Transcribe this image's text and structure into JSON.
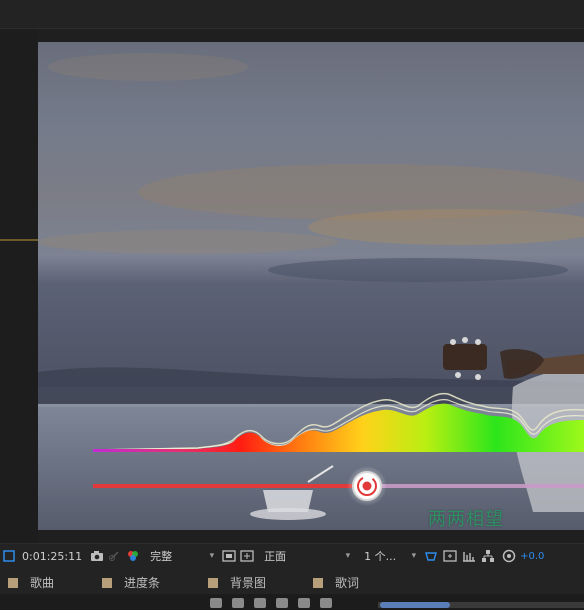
{
  "viewer": {
    "watermark": "两两相望"
  },
  "toolbar": {
    "timecode": "0:01:25:11",
    "resolution": "完整",
    "view": "正面",
    "views_count": "1 个...",
    "exposure": "+0.0",
    "icons": [
      "camera-icon",
      "color-channel-icon",
      "region-of-interest-icon",
      "transparency-grid-icon",
      "fast-preview-icon",
      "3d-view-icon",
      "reset-exposure-icon"
    ]
  },
  "tracks": [
    {
      "label": "歌曲"
    },
    {
      "label": "进度条"
    },
    {
      "label": "背景图"
    },
    {
      "label": "歌词"
    }
  ],
  "colors": {
    "accent_blue": "#2d8ceb",
    "track_swatch": "#b79f7a",
    "progress_red": "#e23a3a",
    "progress_remaining": "#c79ac7"
  }
}
